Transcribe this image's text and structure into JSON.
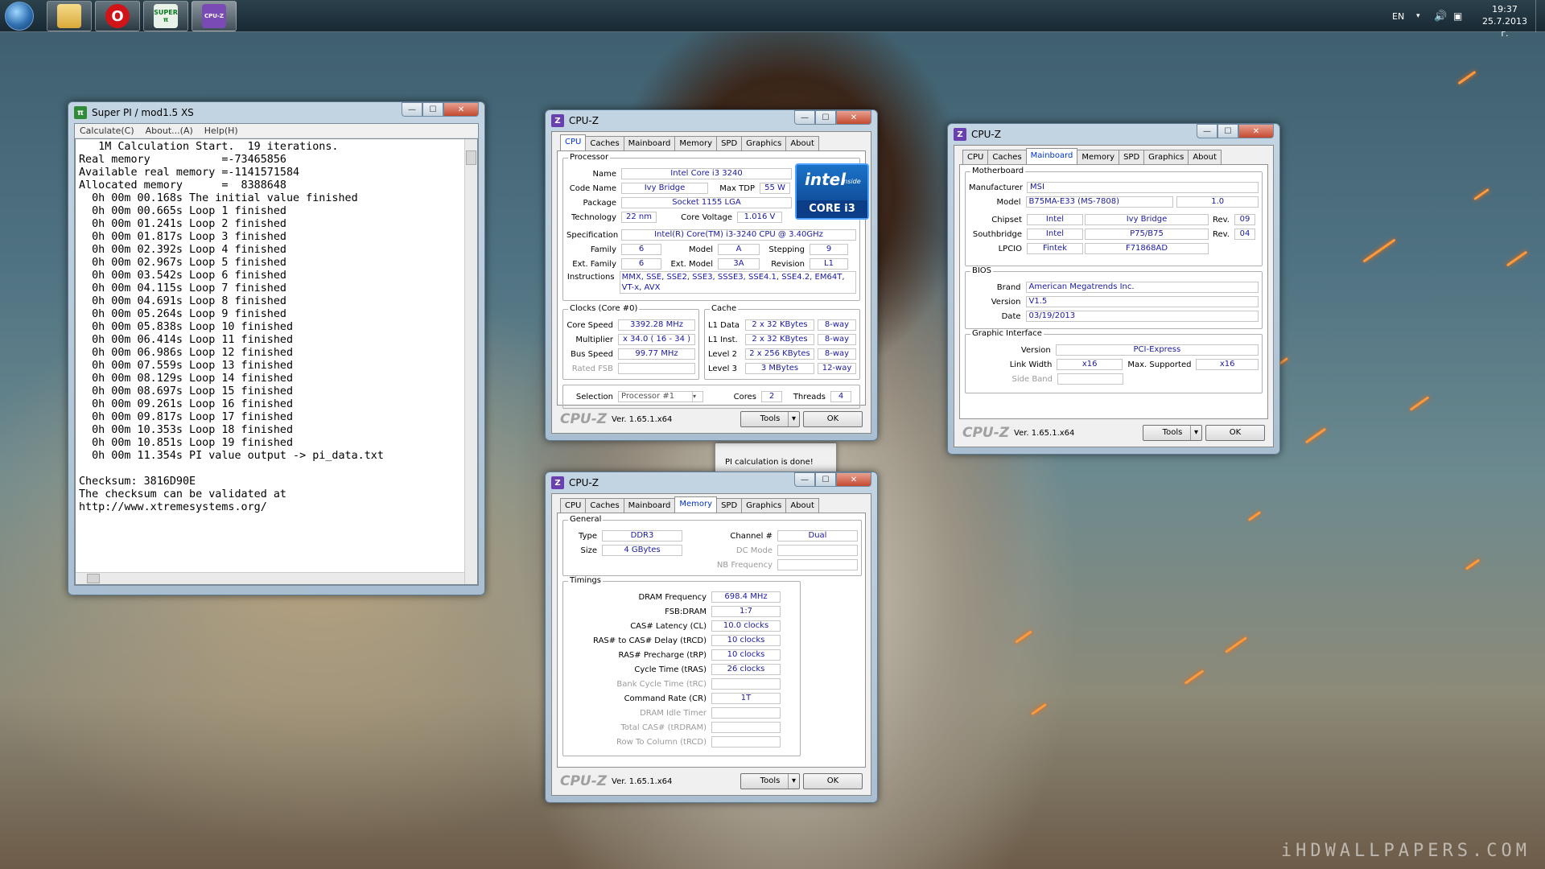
{
  "wallpaper": {
    "watermark": "iHDWALLPAPERS.COM"
  },
  "taskbar": {
    "apps": [
      {
        "name": "explorer",
        "label": ""
      },
      {
        "name": "opera",
        "label": "O"
      },
      {
        "name": "superpi",
        "label": "SUPER π"
      },
      {
        "name": "cpuz",
        "label": "CPU-Z"
      }
    ],
    "language": "EN",
    "time": "19:37",
    "date": "25.7.2013 г."
  },
  "superpi": {
    "title": "Super PI / mod1.5 XS",
    "menu": [
      "Calculate(C)",
      "About...(A)",
      "Help(H)"
    ],
    "output": "   1M Calculation Start.  19 iterations.\nReal memory           =-73465856\nAvailable real memory =-1141571584\nAllocated memory      =  8388648\n  0h 00m 00.168s The initial value finished\n  0h 00m 00.665s Loop 1 finished\n  0h 00m 01.241s Loop 2 finished\n  0h 00m 01.817s Loop 3 finished\n  0h 00m 02.392s Loop 4 finished\n  0h 00m 02.967s Loop 5 finished\n  0h 00m 03.542s Loop 6 finished\n  0h 00m 04.115s Loop 7 finished\n  0h 00m 04.691s Loop 8 finished\n  0h 00m 05.264s Loop 9 finished\n  0h 00m 05.838s Loop 10 finished\n  0h 00m 06.414s Loop 11 finished\n  0h 00m 06.986s Loop 12 finished\n  0h 00m 07.559s Loop 13 finished\n  0h 00m 08.129s Loop 14 finished\n  0h 00m 08.697s Loop 15 finished\n  0h 00m 09.261s Loop 16 finished\n  0h 00m 09.817s Loop 17 finished\n  0h 00m 10.353s Loop 18 finished\n  0h 00m 10.851s Loop 19 finished\n  0h 00m 11.354s PI value output -> pi_data.txt\n\nChecksum: 3816D90E\nThe checksum can be validated at\nhttp://www.xtremesystems.org/"
  },
  "dialog": {
    "message": "PI calculation is done!"
  },
  "cpuz_common": {
    "title": "CPU-Z",
    "tabs": [
      "CPU",
      "Caches",
      "Mainboard",
      "Memory",
      "SPD",
      "Graphics",
      "About"
    ],
    "logo": "CPU-Z",
    "version": "Ver. 1.65.1.x64",
    "tools_label": "Tools",
    "ok_label": "OK"
  },
  "cpu": {
    "processor_label": "Processor",
    "name_label": "Name",
    "name": "Intel Core i3 3240",
    "codename_label": "Code Name",
    "codename": "Ivy Bridge",
    "tdp_label": "Max TDP",
    "tdp": "55 W",
    "package_label": "Package",
    "package": "Socket 1155 LGA",
    "technology_label": "Technology",
    "technology": "22 nm",
    "voltage_label": "Core Voltage",
    "voltage": "1.016 V",
    "spec_label": "Specification",
    "spec": "Intel(R) Core(TM) i3-3240 CPU @ 3.40GHz",
    "family_label": "Family",
    "family": "6",
    "model_label": "Model",
    "model": "A",
    "stepping_label": "Stepping",
    "stepping": "9",
    "extfamily_label": "Ext. Family",
    "extfamily": "6",
    "extmodel_label": "Ext. Model",
    "extmodel": "3A",
    "revision_label": "Revision",
    "revision": "L1",
    "instructions_label": "Instructions",
    "instructions1": "MMX, SSE, SSE2, SSE3, SSSE3, SSE4.1, SSE4.2, EM64T,",
    "instructions2": "VT-x, AVX",
    "clocks_label": "Clocks (Core #0)",
    "corespeed_label": "Core Speed",
    "corespeed": "3392.28 MHz",
    "multiplier_label": "Multiplier",
    "multiplier": "x 34.0 ( 16 - 34 )",
    "busspeed_label": "Bus Speed",
    "busspeed": "99.77 MHz",
    "ratedfsb_label": "Rated FSB",
    "cache_label": "Cache",
    "l1d_label": "L1 Data",
    "l1d": "2 x 32 KBytes",
    "l1d_way": "8-way",
    "l1i_label": "L1 Inst.",
    "l1i": "2 x 32 KBytes",
    "l1i_way": "8-way",
    "l2_label": "Level 2",
    "l2": "2 x 256 KBytes",
    "l2_way": "8-way",
    "l3_label": "Level 3",
    "l3": "3 MBytes",
    "l3_way": "12-way",
    "selection_label": "Selection",
    "selection": "Processor #1",
    "cores_label": "Cores",
    "cores": "2",
    "threads_label": "Threads",
    "threads": "4",
    "intel_logo": {
      "brand": "intel",
      "inside": "inside",
      "line": "CORE i3"
    }
  },
  "mainboard": {
    "motherboard_label": "Motherboard",
    "manufacturer_label": "Manufacturer",
    "manufacturer": "MSI",
    "model_label": "Model",
    "model": "B75MA-E33 (MS-7808)",
    "model_rev": "1.0",
    "chipset_label": "Chipset",
    "chipset_vendor": "Intel",
    "chipset": "Ivy Bridge",
    "chipset_rev_label": "Rev.",
    "chipset_rev": "09",
    "southbridge_label": "Southbridge",
    "sb_vendor": "Intel",
    "sb": "P75/B75",
    "sb_rev_label": "Rev.",
    "sb_rev": "04",
    "lpcio_label": "LPCIO",
    "lpcio_vendor": "Fintek",
    "lpcio": "F71868AD",
    "bios_label": "BIOS",
    "brand_label": "Brand",
    "brand": "American Megatrends Inc.",
    "version_label": "Version",
    "version": "V1.5",
    "date_label": "Date",
    "date": "03/19/2013",
    "gi_label": "Graphic Interface",
    "gi_version_label": "Version",
    "gi_version": "PCI-Express",
    "linkwidth_label": "Link Width",
    "linkwidth": "x16",
    "maxsupported_label": "Max. Supported",
    "maxsupported": "x16",
    "sideband_label": "Side Band"
  },
  "memory": {
    "general_label": "General",
    "type_label": "Type",
    "type": "DDR3",
    "size_label": "Size",
    "size": "4 GBytes",
    "channel_label": "Channel #",
    "channel": "Dual",
    "dcmode_label": "DC Mode",
    "nbfreq_label": "NB Frequency",
    "timings_label": "Timings",
    "dram_freq_label": "DRAM Frequency",
    "dram_freq": "698.4 MHz",
    "fsbdram_label": "FSB:DRAM",
    "fsbdram": "1:7",
    "cas_label": "CAS# Latency (CL)",
    "cas": "10.0 clocks",
    "trcd_label": "RAS# to CAS# Delay (tRCD)",
    "trcd": "10 clocks",
    "trp_label": "RAS# Precharge (tRP)",
    "trp": "10 clocks",
    "tras_label": "Cycle Time (tRAS)",
    "tras": "26 clocks",
    "trc_label": "Bank Cycle Time (tRC)",
    "cr_label": "Command Rate (CR)",
    "cr": "1T",
    "idle_label": "DRAM Idle Timer",
    "trdram_label": "Total CAS# (tRDRAM)",
    "trcd2_label": "Row To Column (tRCD)"
  }
}
